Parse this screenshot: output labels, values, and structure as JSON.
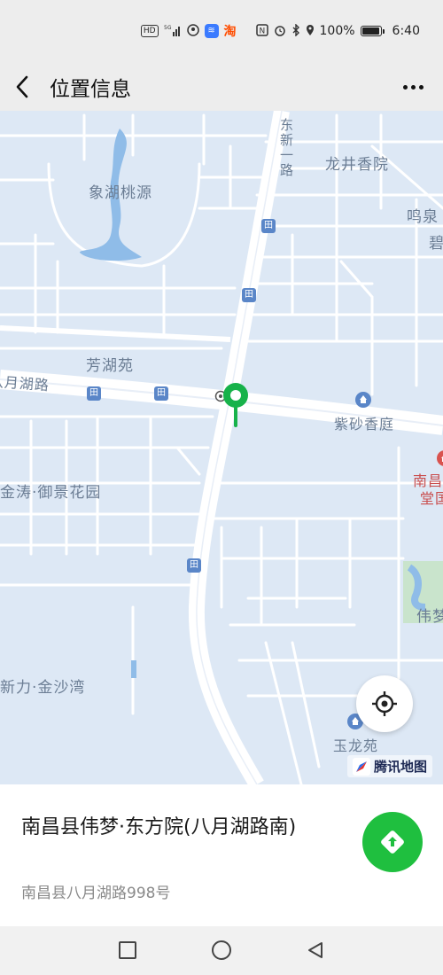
{
  "status_bar": {
    "network_badge": "HD",
    "signal_label": "5G",
    "app_icon_1": "app-blue-icon",
    "app_icon_2_text": "淘",
    "battery_text": "100%",
    "battery_level": 1.0,
    "time": "6:40"
  },
  "nav": {
    "title": "位置信息",
    "back_icon": "chevron-left-icon",
    "more_icon": "more-dots-icon"
  },
  "map": {
    "labels": {
      "dongxin_road": "东新一路",
      "longjing": "龙井香院",
      "xianghu": "象湖桃源",
      "mingquan": "鸣泉",
      "bi": "碧",
      "fanghu": "芳湖苑",
      "bayue_road": "八月湖路",
      "zisha": "紫砂香庭",
      "jintao": "金涛·御景花园",
      "nanchang_top": "南昌",
      "nanchang_bottom": "堂国",
      "weimeng": "伟梦",
      "xinli": "新力·金沙湾",
      "yulong": "玉龙苑"
    },
    "bus_stop_glyph": "田",
    "locate_icon": "crosshair-icon",
    "provider": "腾讯地图"
  },
  "place": {
    "name": "南昌县伟梦·东方院(八月湖路南)",
    "address": "南昌县八月湖路998号",
    "navigate_icon": "navigate-arrow-icon"
  },
  "system_nav": {
    "recents_icon": "square-icon",
    "home_icon": "circle-icon",
    "back_icon": "triangle-back-icon"
  },
  "colors": {
    "map_bg": "#dde8f5",
    "road": "#ffffff",
    "accent_green": "#1fbf3f",
    "pin_green": "#17b24a",
    "label": "#6b7d94"
  }
}
